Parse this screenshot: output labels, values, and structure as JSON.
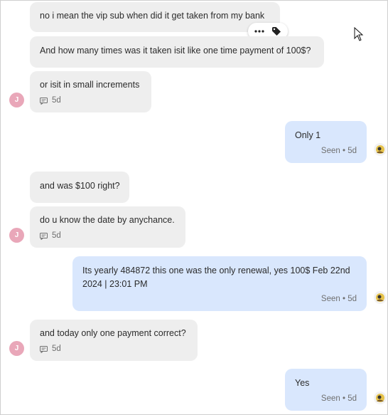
{
  "contact": {
    "avatar_letter": "J",
    "avatar_color": "#e9a7b9"
  },
  "colors": {
    "incoming_bubble": "#eeeeee",
    "outgoing_bubble": "#d9e7fd"
  },
  "messages": [
    {
      "text": "no i mean the vip sub when did it get taken from my bank"
    },
    {
      "text": "And how many times was it taken isit like one time payment of 100$?"
    },
    {
      "text": "or isit in small increments",
      "time": "5d"
    },
    {
      "text": "Only 1",
      "status": "Seen • 5d"
    },
    {
      "text": "and was $100 right?"
    },
    {
      "text": "do u know the date by anychance.",
      "time": "5d"
    },
    {
      "text": "Its yearly 484872 this one was the only renewal, yes 100$ Feb 22nd 2024 | 23:01 PM",
      "status": "Seen • 5d"
    },
    {
      "text": "and today only one payment correct?",
      "time": "5d"
    },
    {
      "text": "Yes",
      "status": "Seen • 5d"
    }
  ],
  "hover_actions": {
    "more_icon": "more-horizontal-icon",
    "tag_icon": "tag-icon"
  }
}
